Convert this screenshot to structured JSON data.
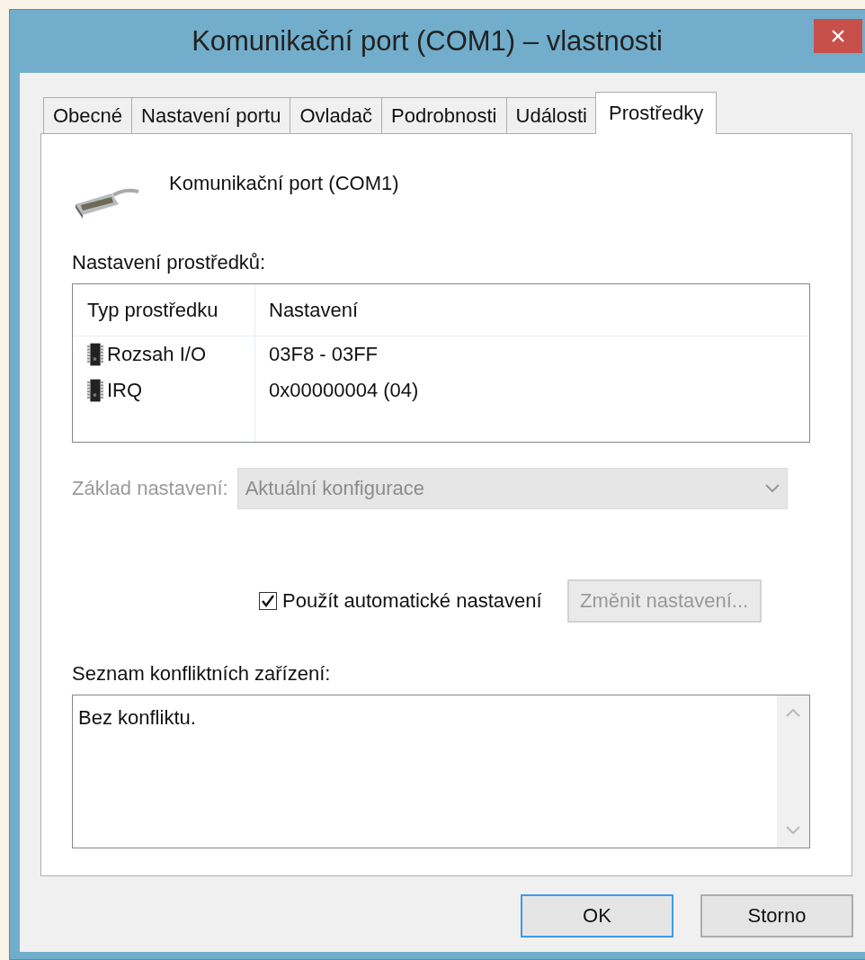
{
  "window": {
    "title": "Komunikační port (COM1)  – vlastnosti",
    "close": "×"
  },
  "tabs": [
    {
      "label": "Obecné",
      "selected": false
    },
    {
      "label": "Nastavení portu",
      "selected": false
    },
    {
      "label": "Ovladač",
      "selected": false
    },
    {
      "label": "Podrobnosti",
      "selected": false
    },
    {
      "label": "Události",
      "selected": false
    },
    {
      "label": "Prostředky",
      "selected": true
    }
  ],
  "device": {
    "name": "Komunikační port (COM1)"
  },
  "resources": {
    "label": "Nastavení prostředků:",
    "columns": [
      "Typ prostředku",
      "Nastavení"
    ],
    "rows": [
      {
        "type": "Rozsah I/O",
        "setting": "03F8 - 03FF"
      },
      {
        "type": "IRQ",
        "setting": "0x00000004 (04)"
      }
    ]
  },
  "settings_based_on": {
    "label": "Základ nastavení:",
    "value": "Aktuální konfigurace",
    "disabled": true
  },
  "auto_settings": {
    "label": "Použít automatické nastavení",
    "checked": true
  },
  "change_button": {
    "label": "Změnit nastavení...",
    "disabled": true
  },
  "conflicts": {
    "label": "Seznam konfliktních zařízení:",
    "value": "Bez konfliktu."
  },
  "buttons": [
    {
      "label": "OK",
      "default": true
    },
    {
      "label": "Storno",
      "default": false
    }
  ]
}
